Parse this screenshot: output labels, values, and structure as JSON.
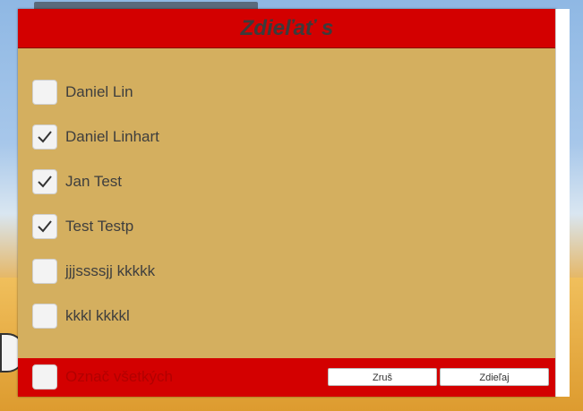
{
  "dialog": {
    "title": "Zdieľať s",
    "contacts": [
      {
        "name": "Daniel Lin",
        "checked": false
      },
      {
        "name": "Daniel Linhart",
        "checked": true
      },
      {
        "name": "Jan Test",
        "checked": true
      },
      {
        "name": "Test Testp",
        "checked": true
      },
      {
        "name": "jjjssssjj kkkkk",
        "checked": false
      },
      {
        "name": "kkkl kkkkl",
        "checked": false
      }
    ],
    "select_all_label": "Označ všetkých",
    "select_all_checked": false,
    "cancel_label": "Zruš",
    "share_label": "Zdieľaj"
  },
  "colors": {
    "header": "#d30000",
    "body": "#d4af5f",
    "footer": "#d30000"
  }
}
